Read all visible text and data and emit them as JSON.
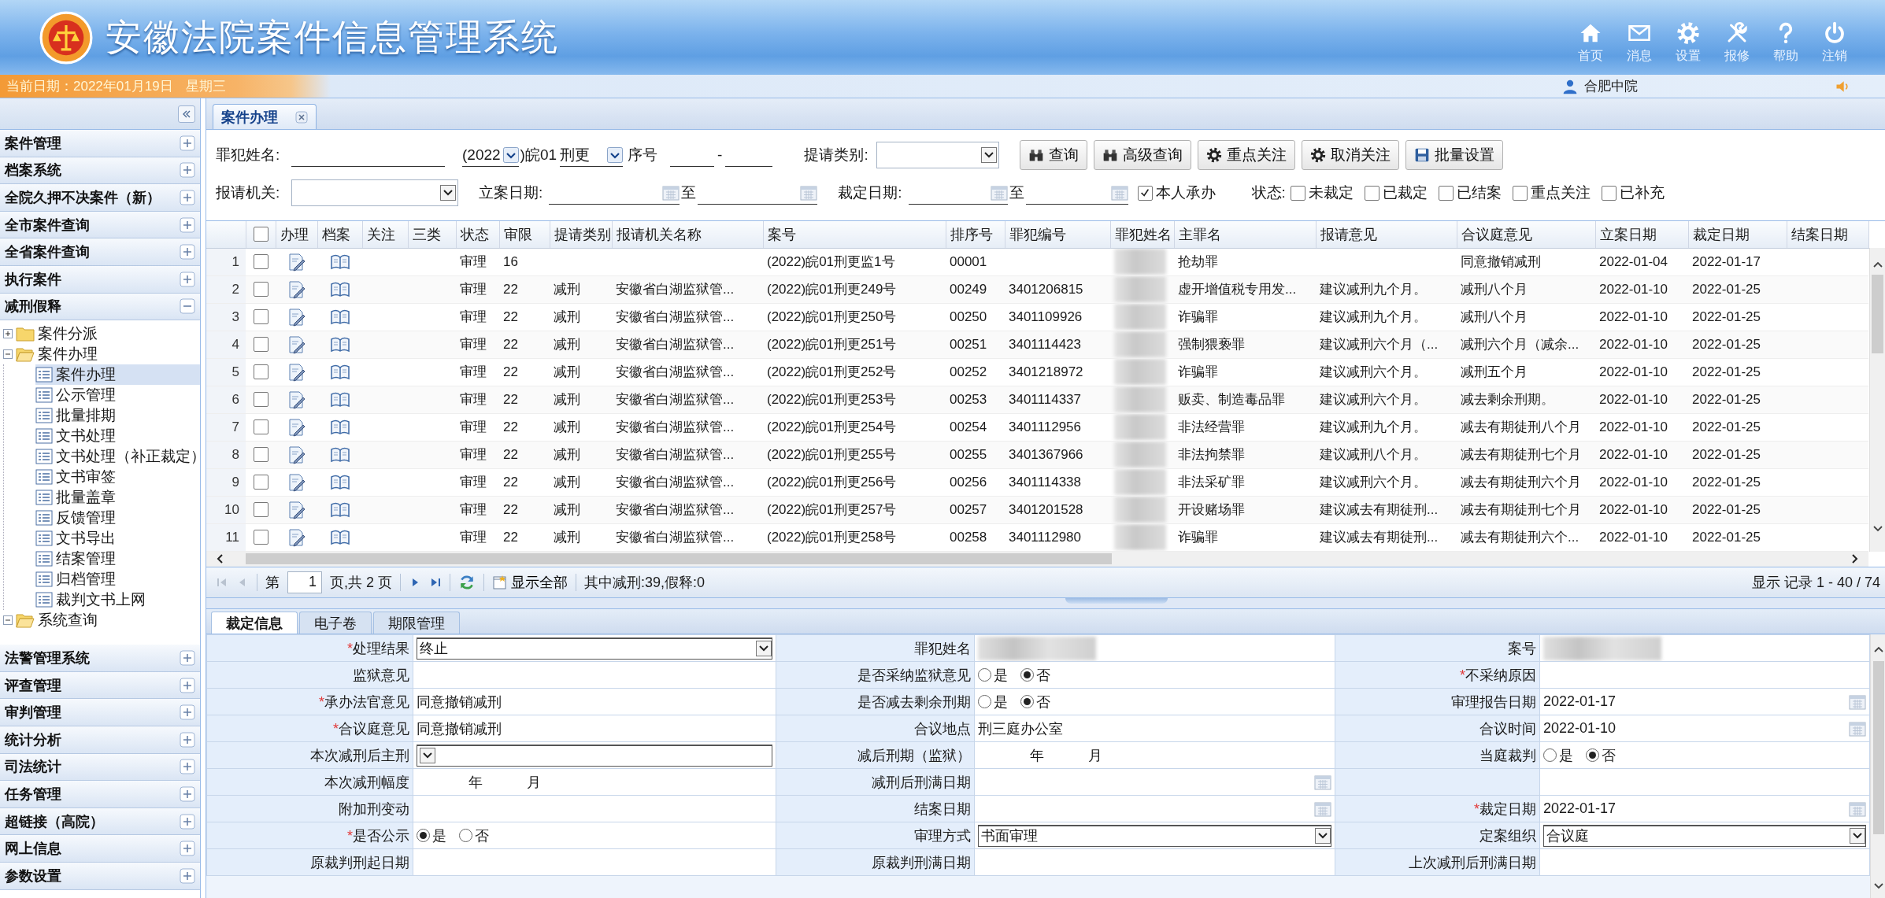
{
  "header": {
    "title": "安徽法院案件信息管理系统",
    "toolbar": [
      {
        "label": "首页",
        "kind": "home"
      },
      {
        "label": "消息",
        "kind": "mail"
      },
      {
        "label": "设置",
        "kind": "settings"
      },
      {
        "label": "报修",
        "kind": "repair"
      },
      {
        "label": "帮助",
        "kind": "help"
      },
      {
        "label": "注销",
        "kind": "logout"
      }
    ]
  },
  "status_bar": {
    "date": "当前日期：2022年01月19日",
    "weekday": "星期三",
    "user": "合肥中院"
  },
  "sidebar": {
    "items": [
      {
        "label": "案件管理",
        "expanded": false
      },
      {
        "label": "档案系统",
        "expanded": false
      },
      {
        "label": "全院久押不决案件（新）",
        "expanded": false
      },
      {
        "label": "全市案件查询",
        "expanded": false
      },
      {
        "label": "全省案件查询",
        "expanded": false
      },
      {
        "label": "执行案件",
        "expanded": false
      },
      {
        "label": "减刑假释",
        "expanded": true,
        "children": [
          {
            "label": "案件分派",
            "kind": "folder",
            "expanded": false
          },
          {
            "label": "案件办理",
            "kind": "folder",
            "expanded": true,
            "children": [
              {
                "label": "案件办理",
                "kind": "page",
                "selected": true
              },
              {
                "label": "公示管理",
                "kind": "page",
                "selected": false
              },
              {
                "label": "批量排期",
                "kind": "page",
                "selected": false
              },
              {
                "label": "文书处理",
                "kind": "page",
                "selected": false
              },
              {
                "label": "文书处理（补正裁定）",
                "kind": "page",
                "selected": false
              },
              {
                "label": "文书审签",
                "kind": "page",
                "selected": false
              },
              {
                "label": "批量盖章",
                "kind": "page",
                "selected": false
              },
              {
                "label": "反馈管理",
                "kind": "page",
                "selected": false
              },
              {
                "label": "文书导出",
                "kind": "page",
                "selected": false
              },
              {
                "label": "结案管理",
                "kind": "page",
                "selected": false
              },
              {
                "label": "归档管理",
                "kind": "page",
                "selected": false
              },
              {
                "label": "裁判文书上网",
                "kind": "page",
                "selected": false
              }
            ]
          },
          {
            "label": "系统查询",
            "kind": "folder",
            "expanded": true
          }
        ]
      },
      {
        "label": "法警管理系统",
        "expanded": false
      },
      {
        "label": "评查管理",
        "expanded": false
      },
      {
        "label": "审判管理",
        "expanded": false
      },
      {
        "label": "统计分析",
        "expanded": false
      },
      {
        "label": "司法统计",
        "expanded": false
      },
      {
        "label": "任务管理",
        "expanded": false
      },
      {
        "label": "超链接（高院）",
        "expanded": false
      },
      {
        "label": "网上信息",
        "expanded": false
      },
      {
        "label": "参数设置",
        "expanded": false
      }
    ]
  },
  "tabs": [
    {
      "label": "案件办理",
      "selected": true
    }
  ],
  "filters": {
    "criminal_name": {
      "label": "罪犯姓名:"
    },
    "case_year": {
      "value": "(2022"
    },
    "court_code": ")皖01",
    "case_type": {
      "value": "刑更"
    },
    "sequence": {
      "label": "序号",
      "separator": "-"
    },
    "request_type": {
      "label": "提请类别:"
    },
    "buttons": [
      {
        "label": "查询",
        "kind": "search"
      },
      {
        "label": "高级查询",
        "kind": "advanced-search"
      },
      {
        "label": "重点关注",
        "kind": "follow"
      },
      {
        "label": "取消关注",
        "kind": "unfollow"
      },
      {
        "label": "批量设置",
        "kind": "batch"
      }
    ],
    "reporting_agency": {
      "label": "报请机关:"
    },
    "filing_date": {
      "label": "立案日期:",
      "to": "至"
    },
    "ruling_date": {
      "label": "裁定日期:",
      "to": "至"
    },
    "mine": {
      "label": "本人承办",
      "checked": true
    },
    "status": {
      "label": "状态:",
      "options": [
        {
          "label": "未裁定",
          "checked": false
        },
        {
          "label": "已裁定",
          "checked": false
        },
        {
          "label": "已结案",
          "checked": false
        },
        {
          "label": "重点关注",
          "checked": false
        },
        {
          "label": "已补充",
          "checked": false
        }
      ]
    }
  },
  "table": {
    "select_all": {
      "checked": false
    },
    "columns": [
      {
        "label": "办理",
        "kind": "edit"
      },
      {
        "label": "档案",
        "kind": "book"
      },
      {
        "label": "关注",
        "kind": "text"
      },
      {
        "label": "三类",
        "kind": "text"
      },
      {
        "label": "状态",
        "kind": "text"
      },
      {
        "label": "审限",
        "kind": "text"
      },
      {
        "label": "提请类别",
        "kind": "text"
      },
      {
        "label": "报请机关名称",
        "kind": "text"
      },
      {
        "label": "案号",
        "kind": "text"
      },
      {
        "label": "排序号",
        "kind": "text"
      },
      {
        "label": "罪犯编号",
        "kind": "text"
      },
      {
        "label": "罪犯姓名",
        "kind": "redacted"
      },
      {
        "label": "主罪名",
        "kind": "text"
      },
      {
        "label": "报请意见",
        "kind": "text"
      },
      {
        "label": "合议庭意见",
        "kind": "text"
      },
      {
        "label": "立案日期",
        "kind": "text"
      },
      {
        "label": "裁定日期",
        "kind": "text"
      },
      {
        "label": "结案日期",
        "kind": "text"
      }
    ],
    "rows": [
      {
        "number": "1",
        "checked": false,
        "cells": {
          "status": "审理",
          "term": "16",
          "case_no": "(2022)皖01刑更监1号",
          "order_no": "00001",
          "charge": "抢劫罪",
          "panel_opinion": "同意撤销减刑",
          "filing_date": "2022-01-04",
          "ruling_date": "2022-01-17"
        }
      },
      {
        "number": "2",
        "checked": false,
        "cells": {
          "status": "审理",
          "term": "22",
          "request_type": "减刑",
          "agency": "安徽省白湖监狱管...",
          "case_no": "(2022)皖01刑更249号",
          "order_no": "00249",
          "prisoner_no": "3401206815",
          "charge": "虚开增值税专用发...",
          "request_opinion": "建议减刑九个月。",
          "panel_opinion": "减刑八个月",
          "filing_date": "2022-01-10",
          "ruling_date": "2022-01-25"
        }
      },
      {
        "number": "3",
        "checked": false,
        "cells": {
          "status": "审理",
          "term": "22",
          "request_type": "减刑",
          "agency": "安徽省白湖监狱管...",
          "case_no": "(2022)皖01刑更250号",
          "order_no": "00250",
          "prisoner_no": "3401109926",
          "charge": "诈骗罪",
          "request_opinion": "建议减刑九个月。",
          "panel_opinion": "减刑八个月",
          "filing_date": "2022-01-10",
          "ruling_date": "2022-01-25"
        }
      },
      {
        "number": "4",
        "checked": false,
        "cells": {
          "status": "审理",
          "term": "22",
          "request_type": "减刑",
          "agency": "安徽省白湖监狱管...",
          "case_no": "(2022)皖01刑更251号",
          "order_no": "00251",
          "prisoner_no": "3401114423",
          "charge": "强制猥亵罪",
          "request_opinion": "建议减刑六个月（...",
          "panel_opinion": "减刑六个月（减余...",
          "filing_date": "2022-01-10",
          "ruling_date": "2022-01-25"
        }
      },
      {
        "number": "5",
        "checked": false,
        "cells": {
          "status": "审理",
          "term": "22",
          "request_type": "减刑",
          "agency": "安徽省白湖监狱管...",
          "case_no": "(2022)皖01刑更252号",
          "order_no": "00252",
          "prisoner_no": "3401218972",
          "charge": "诈骗罪",
          "request_opinion": "建议减刑六个月。",
          "panel_opinion": "减刑五个月",
          "filing_date": "2022-01-10",
          "ruling_date": "2022-01-25"
        }
      },
      {
        "number": "6",
        "checked": false,
        "cells": {
          "status": "审理",
          "term": "22",
          "request_type": "减刑",
          "agency": "安徽省白湖监狱管...",
          "case_no": "(2022)皖01刑更253号",
          "order_no": "00253",
          "prisoner_no": "3401114337",
          "charge": "贩卖、制造毒品罪",
          "request_opinion": "建议减刑六个月。",
          "panel_opinion": "减去剩余刑期。",
          "filing_date": "2022-01-10",
          "ruling_date": "2022-01-25"
        }
      },
      {
        "number": "7",
        "checked": false,
        "cells": {
          "status": "审理",
          "term": "22",
          "request_type": "减刑",
          "agency": "安徽省白湖监狱管...",
          "case_no": "(2022)皖01刑更254号",
          "order_no": "00254",
          "prisoner_no": "3401112956",
          "charge": "非法经营罪",
          "request_opinion": "建议减刑九个月。",
          "panel_opinion": "减去有期徒刑八个月",
          "filing_date": "2022-01-10",
          "ruling_date": "2022-01-25"
        }
      },
      {
        "number": "8",
        "checked": false,
        "cells": {
          "status": "审理",
          "term": "22",
          "request_type": "减刑",
          "agency": "安徽省白湖监狱管...",
          "case_no": "(2022)皖01刑更255号",
          "order_no": "00255",
          "prisoner_no": "3401367966",
          "charge": "非法拘禁罪",
          "request_opinion": "建议减刑八个月。",
          "panel_opinion": "减去有期徒刑七个月",
          "filing_date": "2022-01-10",
          "ruling_date": "2022-01-25"
        }
      },
      {
        "number": "9",
        "checked": false,
        "cells": {
          "status": "审理",
          "term": "22",
          "request_type": "减刑",
          "agency": "安徽省白湖监狱管...",
          "case_no": "(2022)皖01刑更256号",
          "order_no": "00256",
          "prisoner_no": "3401114338",
          "charge": "非法采矿罪",
          "request_opinion": "建议减刑六个月。",
          "panel_opinion": "减去有期徒刑六个月",
          "filing_date": "2022-01-10",
          "ruling_date": "2022-01-25"
        }
      },
      {
        "number": "10",
        "checked": false,
        "cells": {
          "status": "审理",
          "term": "22",
          "request_type": "减刑",
          "agency": "安徽省白湖监狱管...",
          "case_no": "(2022)皖01刑更257号",
          "order_no": "00257",
          "prisoner_no": "3401201528",
          "charge": "开设赌场罪",
          "request_opinion": "建议减去有期徒刑...",
          "panel_opinion": "减去有期徒刑七个月",
          "filing_date": "2022-01-10",
          "ruling_date": "2022-01-25"
        }
      },
      {
        "number": "11",
        "checked": false,
        "cells": {
          "status": "审理",
          "term": "22",
          "request_type": "减刑",
          "agency": "安徽省白湖监狱管...",
          "case_no": "(2022)皖01刑更258号",
          "order_no": "00258",
          "prisoner_no": "3401112980",
          "charge": "诈骗罪",
          "request_opinion": "建议减去有期徒刑...",
          "panel_opinion": "减去有期徒刑六个...",
          "filing_date": "2022-01-10",
          "ruling_date": "2022-01-25"
        }
      }
    ]
  },
  "pager": {
    "nav": [
      {
        "kind": "first",
        "disabled": true
      },
      {
        "kind": "prev",
        "disabled": true
      },
      {
        "kind": "next",
        "disabled": false
      },
      {
        "kind": "last",
        "disabled": false
      }
    ],
    "page_label": "第",
    "page": "1",
    "of": "页,共 2 页",
    "show_all": "显示全部",
    "summary": "其中减刑:39,假释:0",
    "records": "显示 记录 1 - 40 / 74"
  },
  "detail_tabs": [
    {
      "label": "裁定信息",
      "selected": true
    },
    {
      "label": "电子卷",
      "selected": false
    },
    {
      "label": "期限管理",
      "selected": false
    }
  ],
  "form": {
    "rows": [
      [
        {
          "label": "处理结果",
          "asterisk": "*",
          "value": {
            "kind": "select",
            "text": "终止"
          }
        },
        {
          "label": "罪犯姓名",
          "value": {
            "kind": "redacted"
          }
        },
        {
          "label": "案号",
          "value": {
            "kind": "redacted"
          }
        }
      ],
      [
        {
          "label": "监狱意见",
          "value": {
            "kind": "text"
          }
        },
        {
          "label": "是否采纳监狱意见",
          "value": {
            "kind": "radio",
            "options": [
              {
                "label": "是",
                "selected": false
              },
              {
                "label": "否",
                "selected": true
              }
            ]
          }
        },
        {
          "label": "不采纳原因",
          "asterisk": "*",
          "value": {
            "kind": "text"
          }
        }
      ],
      [
        {
          "label": "承办法官意见",
          "asterisk": "*",
          "value": {
            "kind": "text",
            "text": "同意撤销减刑"
          }
        },
        {
          "label": "是否减去剩余刑期",
          "value": {
            "kind": "radio",
            "options": [
              {
                "label": "是",
                "selected": false
              },
              {
                "label": "否",
                "selected": true
              }
            ]
          }
        },
        {
          "label": "审理报告日期",
          "value": {
            "kind": "date",
            "text": "2022-01-17"
          }
        }
      ],
      [
        {
          "label": "合议庭意见",
          "asterisk": "*",
          "value": {
            "kind": "text",
            "text": "同意撤销减刑"
          }
        },
        {
          "label": "合议地点",
          "value": {
            "kind": "text",
            "text": "刑三庭办公室"
          }
        },
        {
          "label": "合议时间",
          "value": {
            "kind": "date",
            "text": "2022-01-10"
          }
        }
      ],
      [
        {
          "label": "本次减刑后主刑",
          "value": {
            "kind": "select"
          }
        },
        {
          "label": "减后刑期（监狱）",
          "value": {
            "kind": "duration",
            "units": [
              "年",
              "月"
            ]
          }
        },
        {
          "label": "当庭裁判",
          "value": {
            "kind": "radio",
            "options": [
              {
                "label": "是",
                "selected": false
              },
              {
                "label": "否",
                "selected": true
              }
            ]
          }
        }
      ],
      [
        {
          "label": "本次减刑幅度",
          "value": {
            "kind": "duration",
            "units": [
              "年",
              "月"
            ]
          }
        },
        {
          "label": "减刑后刑满日期",
          "value": {
            "kind": "date"
          }
        },
        {
          "value": {
            "kind": "text"
          }
        }
      ],
      [
        {
          "label": "附加刑变动",
          "value": {
            "kind": "text"
          }
        },
        {
          "label": "结案日期",
          "value": {
            "kind": "date"
          }
        },
        {
          "label": "裁定日期",
          "asterisk": "*",
          "value": {
            "kind": "date",
            "text": "2022-01-17"
          }
        }
      ],
      [
        {
          "label": "是否公示",
          "asterisk": "*",
          "value": {
            "kind": "radio",
            "options": [
              {
                "label": "是",
                "selected": true
              },
              {
                "label": "否",
                "selected": false
              }
            ]
          }
        },
        {
          "label": "审理方式",
          "value": {
            "kind": "select",
            "text": "书面审理"
          }
        },
        {
          "label": "定案组织",
          "value": {
            "kind": "select",
            "text": "合议庭"
          }
        }
      ],
      [
        {
          "label": "原裁判刑起日期",
          "value": {
            "kind": "text"
          }
        },
        {
          "label": "原裁判刑满日期",
          "value": {
            "kind": "text"
          }
        },
        {
          "label": "上次减刑后刑满日期",
          "value": {
            "kind": "text"
          }
        }
      ]
    ]
  }
}
